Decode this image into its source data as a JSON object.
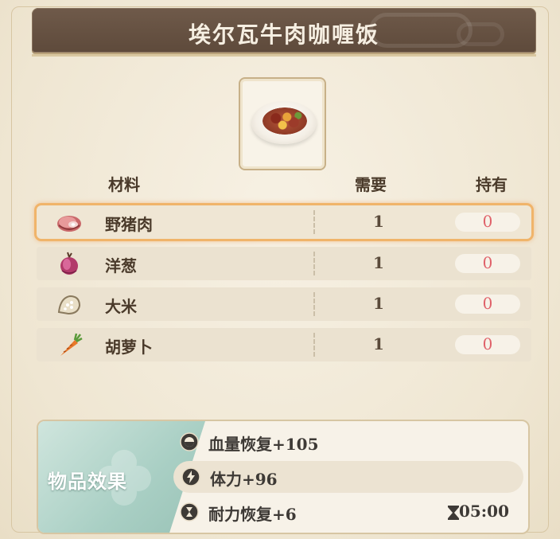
{
  "title": "埃尔瓦牛肉咖喱饭",
  "headers": {
    "material": "材料",
    "need": "需要",
    "have": "持有"
  },
  "ingredients": [
    {
      "name": "野猪肉",
      "need": "1",
      "have": "0",
      "icon": "meat-icon",
      "selected": true
    },
    {
      "name": "洋葱",
      "need": "1",
      "have": "0",
      "icon": "onion-icon",
      "selected": false
    },
    {
      "name": "大米",
      "need": "1",
      "have": "0",
      "icon": "rice-icon",
      "selected": false
    },
    {
      "name": "胡萝卜",
      "need": "1",
      "have": "0",
      "icon": "carrot-icon",
      "selected": false
    }
  ],
  "effects": {
    "label": "物品效果",
    "items": [
      {
        "text": "血量恢复+105",
        "icon": "hp-icon"
      },
      {
        "text": "体力+96",
        "icon": "lightning-icon"
      },
      {
        "text": "耐力恢复+6",
        "icon": "hourglass-icon"
      }
    ],
    "duration": "05:00"
  },
  "colors": {
    "accent": "#f0b46a",
    "have_count": "#e0626a",
    "title_bg": "#6f5a4a",
    "effect_panel": "#a9cfc4"
  }
}
